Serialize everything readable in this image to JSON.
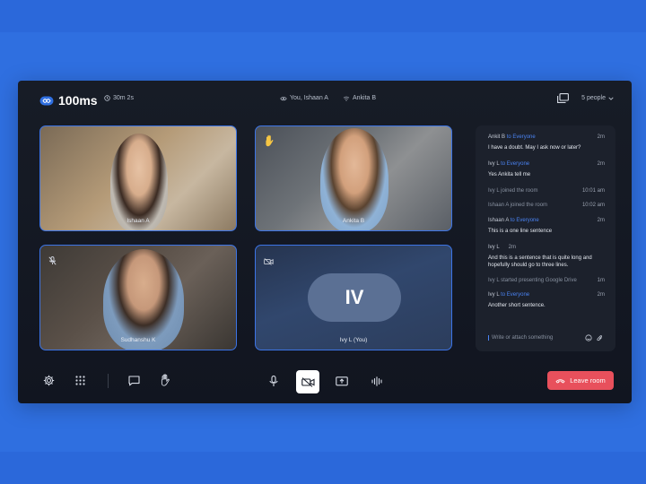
{
  "brand": {
    "name": "100ms"
  },
  "header": {
    "timer": "30m 2s",
    "viewers": [
      {
        "label": "You, Ishaan A",
        "icon": "eye-icon"
      },
      {
        "label": "Ankita B",
        "icon": "wifi-icon"
      }
    ],
    "people_count": "5 people"
  },
  "tiles": [
    {
      "name": "Ishaan A"
    },
    {
      "name": "Ankita B",
      "icon": "raised-hand-icon"
    },
    {
      "name": "Sudhanshu K",
      "icon": "mic-off-icon"
    },
    {
      "name": "Ivy L (You)",
      "initials": "IV",
      "icon": "camera-off-icon"
    }
  ],
  "chat": {
    "messages": [
      {
        "from": "Ankit B",
        "to": "to Everyone",
        "time": "2m",
        "text": "I have a doubt. May I ask now or later?"
      },
      {
        "from": "Ivy L",
        "to": "to Everyone",
        "time": "2m",
        "text": "Yes Ankita tell me"
      },
      {
        "system": "Ivy L joined the room",
        "time": "10:01 am"
      },
      {
        "system": "Ishaan A joined the room",
        "time": "10:02 am"
      },
      {
        "from": "Ishaan A",
        "to": "to Everyone",
        "time": "2m",
        "text": "This is a one line sentence"
      },
      {
        "from": "Ivy L",
        "to": "",
        "time": "2m",
        "text": "And this is a sentence that is quite long and hopefully should go to three lines."
      },
      {
        "system": "Ivy L started presenting Google Drive",
        "time": "1m"
      },
      {
        "from": "Ivy L",
        "to": "to Everyone",
        "time": "2m",
        "text": "Another short sentence."
      }
    ],
    "input_placeholder": "Write or attach something"
  },
  "footer": {
    "leave_label": "Leave room"
  },
  "colors": {
    "accent": "#3c74e6",
    "leave": "#e8505c",
    "background": "#2f6fe0"
  }
}
